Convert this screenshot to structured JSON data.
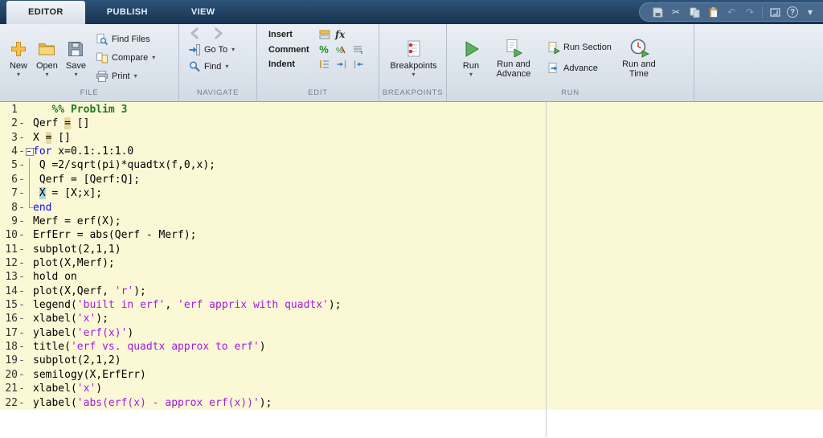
{
  "tabs": [
    {
      "label": "EDITOR"
    },
    {
      "label": "PUBLISH"
    },
    {
      "label": "VIEW"
    }
  ],
  "icons": {
    "dropdown": "▾",
    "percent": "%",
    "cut": "✂",
    "undo": "↶",
    "redo": "↷",
    "help": "?",
    "menu_chevron": "▾"
  },
  "colors": {
    "run_green": "#58b158",
    "keyword_blue": "#0d10e6",
    "string_purple": "#a31ae0",
    "comment_green": "#1e7d1e",
    "cell_highlight": "#fbf8d6",
    "tabbar_navy": "#1d3a5c"
  },
  "ribbon": {
    "file": {
      "label": "FILE",
      "new": "New",
      "open": "Open",
      "save": "Save",
      "find_files": "Find Files",
      "compare": "Compare",
      "print": "Print"
    },
    "navigate": {
      "label": "NAVIGATE",
      "goto": "Go To",
      "find": "Find"
    },
    "edit": {
      "label": "EDIT",
      "insert": "Insert",
      "comment": "Comment",
      "indent": "Indent",
      "fx": "fx"
    },
    "breakpoints": {
      "label": "BREAKPOINTS",
      "button": "Breakpoints"
    },
    "run": {
      "label": "RUN",
      "run": "Run",
      "run_and_advance": "Run and Advance",
      "run_section": "Run Section",
      "advance": "Advance",
      "run_and_time": "Run and Time"
    }
  },
  "editor": {
    "lines": [
      {
        "n": "1",
        "marker": "",
        "fold": "",
        "segments": [
          {
            "t": "   ",
            "c": "plain"
          },
          {
            "t": "%% Problim 3",
            "c": "section"
          }
        ]
      },
      {
        "n": "2",
        "marker": "-",
        "fold": "",
        "segments": [
          {
            "t": "Qerf ",
            "c": "plain"
          },
          {
            "t": "=",
            "c": "eq"
          },
          {
            "t": " []",
            "c": "plain"
          }
        ]
      },
      {
        "n": "3",
        "marker": "-",
        "fold": "",
        "segments": [
          {
            "t": "X ",
            "c": "plain"
          },
          {
            "t": "=",
            "c": "eq"
          },
          {
            "t": " []",
            "c": "plain"
          }
        ]
      },
      {
        "n": "4",
        "marker": "-",
        "fold": "open",
        "segments": [
          {
            "t": "for",
            "c": "kw"
          },
          {
            "t": " x=0.1:.1:1.0",
            "c": "plain"
          }
        ]
      },
      {
        "n": "5",
        "marker": "-",
        "fold": "mid",
        "segments": [
          {
            "t": " Q =2/sqrt(pi)*quadtx(f,0,x);",
            "c": "plain"
          }
        ]
      },
      {
        "n": "6",
        "marker": "-",
        "fold": "mid",
        "segments": [
          {
            "t": " Qerf = [Qerf:Q];",
            "c": "plain"
          }
        ]
      },
      {
        "n": "7",
        "marker": "-",
        "fold": "mid",
        "segments": [
          {
            "t": " ",
            "c": "plain"
          },
          {
            "t": "X",
            "c": "varhl"
          },
          {
            "t": " = [X;x];",
            "c": "plain"
          }
        ]
      },
      {
        "n": "8",
        "marker": "-",
        "fold": "end",
        "segments": [
          {
            "t": "end",
            "c": "kw"
          }
        ]
      },
      {
        "n": "9",
        "marker": "-",
        "fold": "",
        "segments": [
          {
            "t": "Merf = erf(X);",
            "c": "plain"
          }
        ]
      },
      {
        "n": "10",
        "marker": "-",
        "fold": "",
        "segments": [
          {
            "t": "ErfErr = abs(Qerf - Merf);",
            "c": "plain"
          }
        ]
      },
      {
        "n": "11",
        "marker": "-",
        "fold": "",
        "segments": [
          {
            "t": "subplot(2,1,1)",
            "c": "plain"
          }
        ]
      },
      {
        "n": "12",
        "marker": "-",
        "fold": "",
        "segments": [
          {
            "t": "plot(X,Merf);",
            "c": "plain"
          }
        ]
      },
      {
        "n": "13",
        "marker": "-",
        "fold": "",
        "segments": [
          {
            "t": "hold on",
            "c": "plain"
          }
        ]
      },
      {
        "n": "14",
        "marker": "-",
        "fold": "",
        "segments": [
          {
            "t": "plot(X,Qerf, ",
            "c": "plain"
          },
          {
            "t": "'r'",
            "c": "str"
          },
          {
            "t": ");",
            "c": "plain"
          }
        ]
      },
      {
        "n": "15",
        "marker": "-",
        "fold": "",
        "segments": [
          {
            "t": "legend(",
            "c": "plain"
          },
          {
            "t": "'built in erf'",
            "c": "str"
          },
          {
            "t": ", ",
            "c": "plain"
          },
          {
            "t": "'erf apprix with quadtx'",
            "c": "str"
          },
          {
            "t": ");",
            "c": "plain"
          }
        ]
      },
      {
        "n": "16",
        "marker": "-",
        "fold": "",
        "segments": [
          {
            "t": "xlabel(",
            "c": "plain"
          },
          {
            "t": "'x'",
            "c": "str"
          },
          {
            "t": ");",
            "c": "plain"
          }
        ]
      },
      {
        "n": "17",
        "marker": "-",
        "fold": "",
        "segments": [
          {
            "t": "ylabel(",
            "c": "plain"
          },
          {
            "t": "'erf(x)'",
            "c": "str"
          },
          {
            "t": ")",
            "c": "plain"
          }
        ]
      },
      {
        "n": "18",
        "marker": "-",
        "fold": "",
        "segments": [
          {
            "t": "title(",
            "c": "plain"
          },
          {
            "t": "'erf vs. quadtx approx to erf'",
            "c": "str"
          },
          {
            "t": ")",
            "c": "plain"
          }
        ]
      },
      {
        "n": "19",
        "marker": "-",
        "fold": "",
        "segments": [
          {
            "t": "subplot(2,1,2)",
            "c": "plain"
          }
        ]
      },
      {
        "n": "20",
        "marker": "-",
        "fold": "",
        "segments": [
          {
            "t": "semilogy(X,ErfErr)",
            "c": "plain"
          }
        ]
      },
      {
        "n": "21",
        "marker": "-",
        "fold": "",
        "segments": [
          {
            "t": "xlabel(",
            "c": "plain"
          },
          {
            "t": "'x'",
            "c": "str"
          },
          {
            "t": ")",
            "c": "plain"
          }
        ]
      },
      {
        "n": "22",
        "marker": "-",
        "fold": "",
        "segments": [
          {
            "t": "ylabel(",
            "c": "plain"
          },
          {
            "t": "'abs(erf(x) - approx erf(x))'",
            "c": "str"
          },
          {
            "t": ");",
            "c": "plain"
          }
        ]
      }
    ]
  }
}
